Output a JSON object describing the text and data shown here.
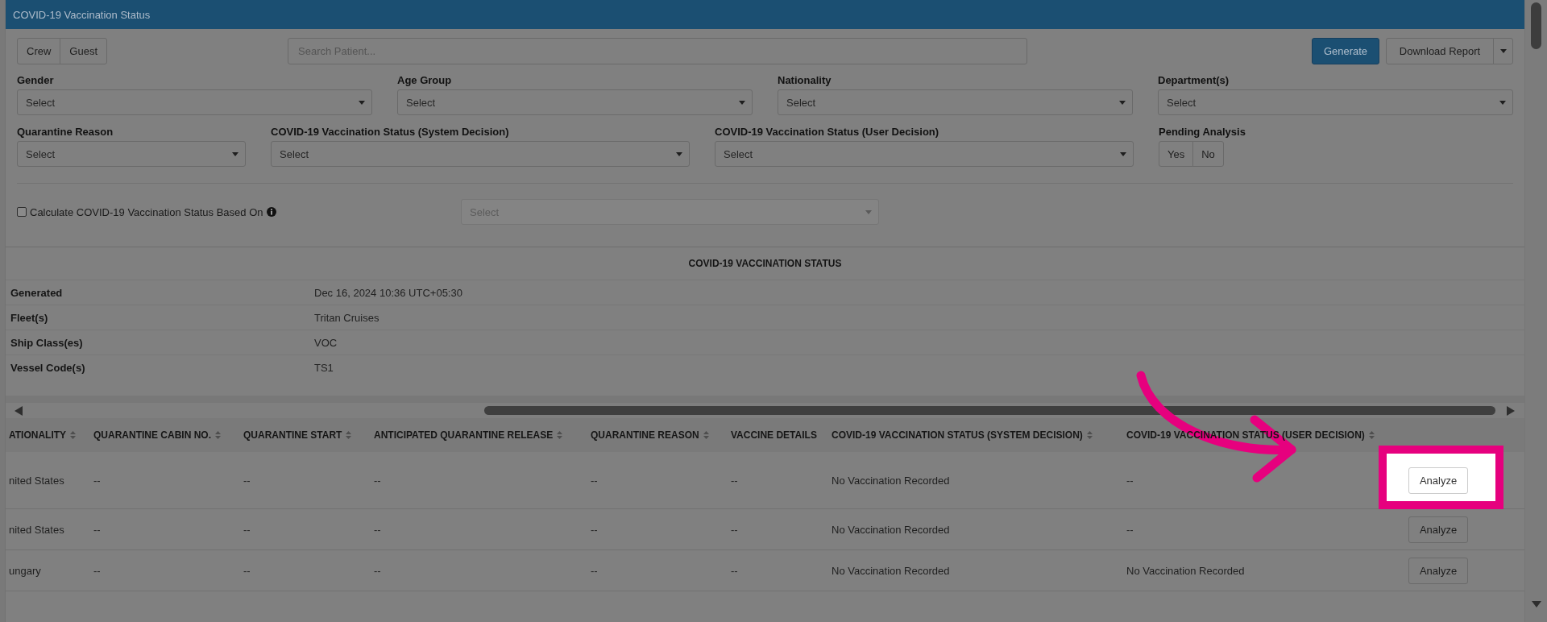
{
  "window": {
    "title": "COVID-19 Vaccination Status"
  },
  "toolbar": {
    "segments": [
      {
        "label": "Crew",
        "selected": false
      },
      {
        "label": "Guest",
        "selected": false
      }
    ],
    "search": {
      "placeholder": "Search Patient..."
    },
    "generate": {
      "label": "Generate"
    },
    "download": {
      "label": "Download Report"
    }
  },
  "filter_rows": [
    {
      "filters": [
        {
          "label": "Gender",
          "kind": "select",
          "placeholder": "Select"
        },
        {
          "label": "Age Group",
          "kind": "select",
          "placeholder": "Select"
        },
        {
          "label": "Nationality",
          "kind": "select",
          "placeholder": "Select"
        },
        {
          "label": "Department(s)",
          "kind": "select",
          "placeholder": "Select"
        }
      ]
    },
    {
      "filters": [
        {
          "label": "Quarantine Reason",
          "kind": "select",
          "placeholder": "Select"
        },
        {
          "label": "COVID-19 Vaccination Status (System Decision)",
          "kind": "select",
          "placeholder": "Select"
        },
        {
          "label": "COVID-19 Vaccination Status (User Decision)",
          "kind": "select",
          "placeholder": "Select"
        },
        {
          "label": "Pending Analysis",
          "kind": "toggle",
          "options": [
            {
              "label": "Yes",
              "selected": false
            },
            {
              "label": "No",
              "selected": false
            }
          ]
        }
      ]
    }
  ],
  "calculate": {
    "label": "Calculate COVID-19 Vaccination Status Based On",
    "checked": false,
    "select": {
      "placeholder": "Select",
      "disabled": true
    }
  },
  "summary": {
    "title": "COVID-19 VACCINATION STATUS",
    "rows": [
      {
        "label": "Generated",
        "value": "Dec 16, 2024 10:36 UTC+05:30"
      },
      {
        "label": "Fleet(s)",
        "value": "Tritan Cruises"
      },
      {
        "label": "Ship Class(es)",
        "value": "VOC"
      },
      {
        "label": "Vessel Code(s)",
        "value": "TS1"
      }
    ]
  },
  "table": {
    "columns": [
      {
        "label": "ATIONALITY",
        "sortable": true
      },
      {
        "label": "QUARANTINE CABIN NO.",
        "sortable": true
      },
      {
        "label": "QUARANTINE START",
        "sortable": true
      },
      {
        "label": "ANTICIPATED QUARANTINE RELEASE",
        "sortable": true
      },
      {
        "label": "QUARANTINE REASON",
        "sortable": true
      },
      {
        "label": "VACCINE DETAILS",
        "sortable": false
      },
      {
        "label": "COVID-19 VACCINATION STATUS (SYSTEM DECISION)",
        "sortable": true
      },
      {
        "label": "COVID-19 VACCINATION STATUS (USER DECISION)",
        "sortable": true
      }
    ],
    "rows": [
      {
        "cells": [
          "nited States",
          "--",
          "--",
          "--",
          "--",
          "--",
          "No Vaccination Recorded",
          "--"
        ],
        "action": "Analyze",
        "highlighted": true
      },
      {
        "cells": [
          "nited States",
          "--",
          "--",
          "--",
          "--",
          "--",
          "No Vaccination Recorded",
          "--"
        ],
        "action": "Analyze",
        "highlighted": false
      },
      {
        "cells": [
          "ungary",
          "--",
          "--",
          "--",
          "--",
          "--",
          "No Vaccination Recorded",
          "No Vaccination Recorded"
        ],
        "action": "Analyze",
        "highlighted": false
      }
    ]
  }
}
